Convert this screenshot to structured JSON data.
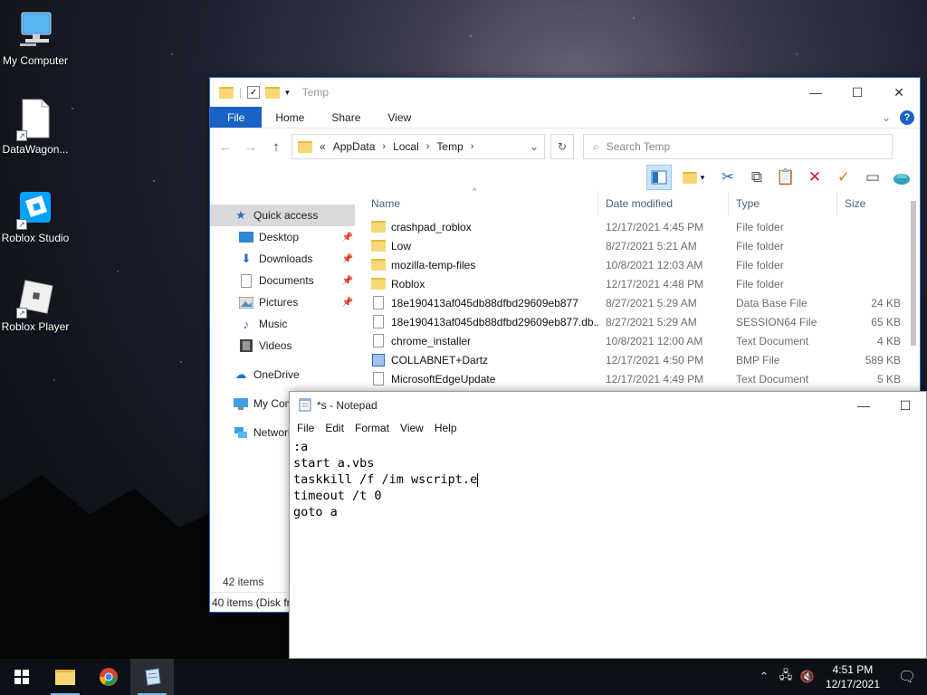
{
  "desktop": {
    "icons": [
      {
        "label": "My Computer"
      },
      {
        "label": "DataWagon..."
      },
      {
        "label": "Roblox Studio"
      },
      {
        "label": "Roblox Player"
      }
    ]
  },
  "explorer": {
    "title": "Temp",
    "tabs": {
      "file": "File",
      "home": "Home",
      "share": "Share",
      "view": "View"
    },
    "address": {
      "prefix": "«",
      "parts": [
        "AppData",
        "Local",
        "Temp"
      ]
    },
    "search_placeholder": "Search Temp",
    "nav": {
      "quick_access": "Quick access",
      "desktop": "Desktop",
      "downloads": "Downloads",
      "documents": "Documents",
      "pictures": "Pictures",
      "music": "Music",
      "videos": "Videos",
      "onedrive": "OneDrive",
      "this_pc": "My Com",
      "network": "Network"
    },
    "columns": {
      "name": "Name",
      "date": "Date modified",
      "type": "Type",
      "size": "Size"
    },
    "files": [
      {
        "name": "crashpad_roblox",
        "date": "12/17/2021 4:45 PM",
        "type": "File folder",
        "size": "",
        "kind": "folder"
      },
      {
        "name": "Low",
        "date": "8/27/2021 5:21 AM",
        "type": "File folder",
        "size": "",
        "kind": "folder"
      },
      {
        "name": "mozilla-temp-files",
        "date": "10/8/2021 12:03 AM",
        "type": "File folder",
        "size": "",
        "kind": "folder"
      },
      {
        "name": "Roblox",
        "date": "12/17/2021 4:48 PM",
        "type": "File folder",
        "size": "",
        "kind": "folder"
      },
      {
        "name": "18e190413af045db88dfbd29609eb877",
        "date": "8/27/2021 5:29 AM",
        "type": "Data Base File",
        "size": "24 KB",
        "kind": "doc"
      },
      {
        "name": "18e190413af045db88dfbd29609eb877.db....",
        "date": "8/27/2021 5:29 AM",
        "type": "SESSION64 File",
        "size": "65 KB",
        "kind": "doc"
      },
      {
        "name": "chrome_installer",
        "date": "10/8/2021 12:00 AM",
        "type": "Text Document",
        "size": "4 KB",
        "kind": "doc"
      },
      {
        "name": "COLLABNET+Dartz",
        "date": "12/17/2021 4:50 PM",
        "type": "BMP File",
        "size": "589 KB",
        "kind": "bmp"
      },
      {
        "name": "MicrosoftEdgeUpdate",
        "date": "12/17/2021 4:49 PM",
        "type": "Text Document",
        "size": "5 KB",
        "kind": "doc"
      }
    ],
    "item_count": "42 items",
    "status_bar": "40 items (Disk fr"
  },
  "notepad": {
    "title": "*s - Notepad",
    "menu": {
      "file": "File",
      "edit": "Edit",
      "format": "Format",
      "view": "View",
      "help": "Help"
    },
    "lines": [
      ":a",
      "start a.vbs",
      "taskkill /f /im wscript.e",
      "timeout /t 0",
      "goto a"
    ]
  },
  "taskbar": {
    "time": "4:51 PM",
    "date": "12/17/2021"
  }
}
